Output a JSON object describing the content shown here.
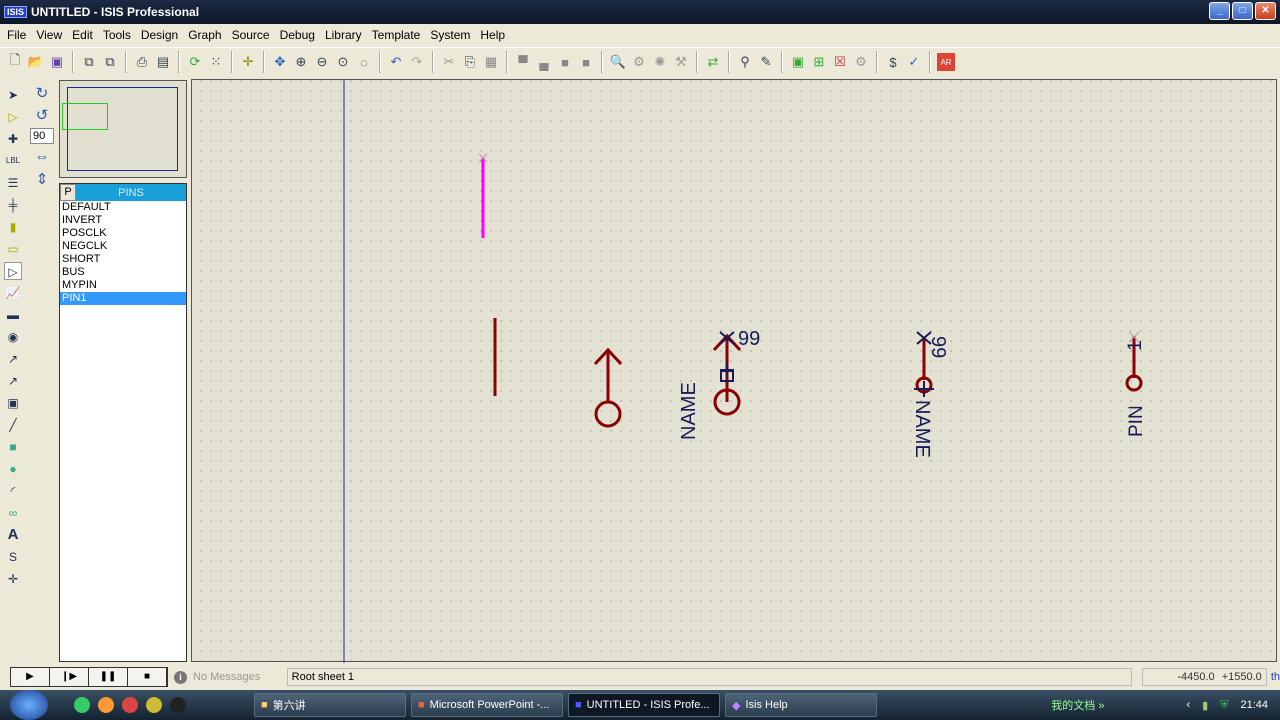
{
  "window": {
    "title": "UNTITLED - ISIS Professional",
    "logo": "ISIS",
    "controls": [
      "minimize",
      "maximize",
      "close"
    ]
  },
  "menu": [
    "File",
    "View",
    "Edit",
    "Tools",
    "Design",
    "Graph",
    "Source",
    "Debug",
    "Library",
    "Template",
    "System",
    "Help"
  ],
  "toolbar": [
    "new-icon",
    "open-icon",
    "save-icon",
    "import-icon",
    "export-icon",
    "print-icon",
    "print-area-icon",
    "refresh-icon",
    "grid-icon",
    "origin-icon",
    "pan-icon",
    "zoom-in-icon",
    "zoom-out-icon",
    "zoom-all-icon",
    "zoom-area-icon",
    "undo-icon",
    "redo-icon",
    "cut-icon",
    "copy-icon",
    "paste-icon",
    "block-copy-icon",
    "block-move-icon",
    "block-rotate-icon",
    "block-delete-icon",
    "pick-device-icon",
    "make-device-icon",
    "packaging-icon",
    "decompose-icon",
    "wire-autorouter-icon",
    "search-tag-icon",
    "property-assign-icon",
    "new-sheet-icon",
    "remove-sheet-icon",
    "goto-child-icon",
    "bom-icon",
    "erc-icon",
    "netlist-ares-icon"
  ],
  "rotation": {
    "value": "90"
  },
  "pins_panel": {
    "p_button": "P",
    "title": "PINS",
    "items": [
      "DEFAULT",
      "INVERT",
      "POSCLK",
      "NEGCLK",
      "SHORT",
      "BUS",
      "MYPIN",
      "PIN1"
    ],
    "selected": "PIN1"
  },
  "canvas": {
    "labels": {
      "name1": "NAME",
      "num1": "99",
      "name2": "NAME",
      "num2": "99",
      "pin_name": "PIN",
      "pin_num": "1"
    },
    "colors": {
      "pin": "#8b0000",
      "selected": "#ff00ff",
      "text": "#1a1a5a",
      "background": "#e2e1d2"
    }
  },
  "status": {
    "messages": "No Messages",
    "sheet": "Root sheet 1",
    "coord_x": "-4450.0",
    "coord_y": "+1550.0",
    "units": "th"
  },
  "taskbar": {
    "tasks": [
      "第六讲",
      "Microsoft PowerPoint -...",
      "UNTITLED - ISIS Profe...",
      "Isis Help"
    ],
    "docs": "我的文档",
    "chevron": "»",
    "clock": "21:44"
  }
}
